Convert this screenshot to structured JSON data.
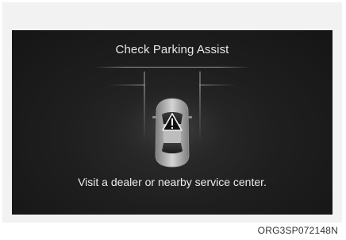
{
  "screen": {
    "title": "Check Parking Assist",
    "message": "Visit a dealer or nearby service center.",
    "warning_icon": "warning-triangle-icon",
    "vehicle_icon": "car-top-view-icon"
  },
  "caption": {
    "code": "ORG3SP072148N"
  },
  "colors": {
    "screen_background": "#1f1f1f",
    "text": "#e8e8e8",
    "frame": "#f2f2f2"
  }
}
